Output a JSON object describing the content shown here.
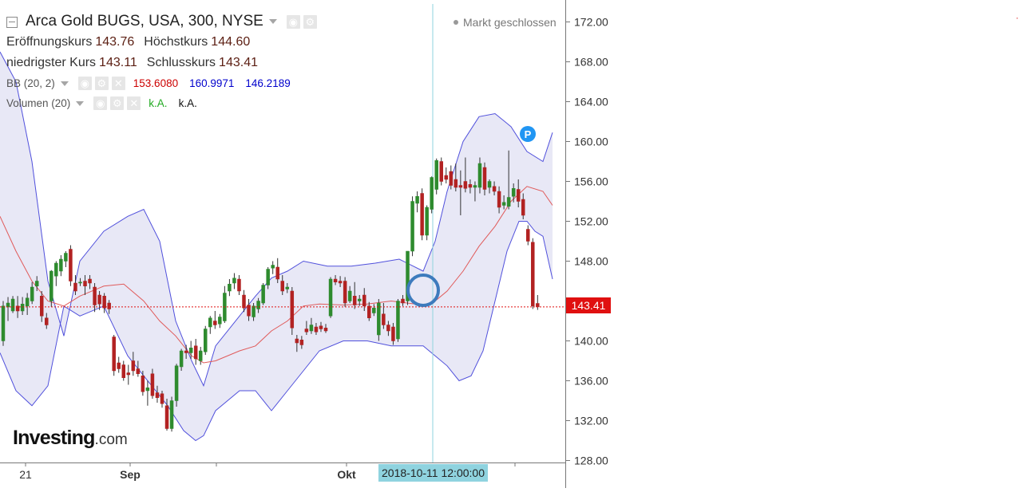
{
  "header": {
    "title": "Arca Gold BUGS, USA, 300, NYSE",
    "market_status": "Markt geschlossen"
  },
  "ohlc": {
    "open_label": "Eröffnungskurs",
    "open": "143.76",
    "high_label": "Höchstkurs",
    "high": "144.60",
    "low_label": "niedrigster Kurs",
    "low": "143.11",
    "close_label": "Schlusskurs",
    "close": "143.41"
  },
  "indicators": {
    "bb": {
      "label": "BB (20, 2)",
      "upper": "153.6080",
      "lower": "160.9971",
      "basis": "146.2189"
    },
    "volume": {
      "label": "Volumen (20)",
      "v1": "k.A.",
      "v2": "k.A."
    }
  },
  "logo": {
    "brand": "Investing",
    "suffix": ".com"
  },
  "price_tag": "143.41",
  "crosshair_time": "2018-10-11 12:00:00",
  "colors": {
    "up": "#2e8b2e",
    "down": "#b22222",
    "bb_band": "#5050dc",
    "bb_fill": "#e4e4f5",
    "bb_basis": "#e05a5a",
    "price_line": "#e01010",
    "crosshair": "#8fd3df",
    "highlight_circle": "#3d7bbd",
    "marker": "#2196f3"
  },
  "chart_data": {
    "type": "candlestick",
    "y_ticks": [
      "172.00",
      "168.00",
      "164.00",
      "160.00",
      "156.00",
      "152.00",
      "148.00",
      "144.00",
      "140.00",
      "136.00",
      "132.00",
      "128.00"
    ],
    "x_ticks": [
      "21",
      "Sep",
      "Okt"
    ],
    "ylim": [
      127.5,
      173.5
    ],
    "last_price": 143.41,
    "event_marker": "P",
    "candles": [
      {
        "o": 140.0,
        "h": 144.0,
        "c": 143.5,
        "l": 139.5
      },
      {
        "o": 143.4,
        "h": 144.4,
        "c": 143.8,
        "l": 142.0
      },
      {
        "o": 143.0,
        "h": 144.5,
        "c": 144.2,
        "l": 142.8
      },
      {
        "o": 143.5,
        "h": 144.5,
        "c": 143.0,
        "l": 142.3
      },
      {
        "o": 143.0,
        "h": 144.4,
        "c": 143.7,
        "l": 142.6
      },
      {
        "o": 143.5,
        "h": 144.8,
        "c": 144.3,
        "l": 142.6
      },
      {
        "o": 144.0,
        "h": 145.9,
        "c": 145.4,
        "l": 143.7
      },
      {
        "o": 145.5,
        "h": 146.5,
        "c": 146.0,
        "l": 145.0
      },
      {
        "o": 144.5,
        "h": 145.0,
        "c": 142.5,
        "l": 141.9
      },
      {
        "o": 142.3,
        "h": 142.8,
        "c": 141.6,
        "l": 141.2
      },
      {
        "o": 144.0,
        "h": 147.1,
        "c": 147.0,
        "l": 143.4
      },
      {
        "o": 146.5,
        "h": 148.0,
        "c": 147.8,
        "l": 145.5
      },
      {
        "o": 147.0,
        "h": 148.6,
        "c": 148.2,
        "l": 146.5
      },
      {
        "o": 148.0,
        "h": 149.0,
        "c": 148.8,
        "l": 147.4
      },
      {
        "o": 149.2,
        "h": 149.6,
        "c": 146.0,
        "l": 145.5
      },
      {
        "o": 145.8,
        "h": 146.6,
        "c": 145.0,
        "l": 144.6
      },
      {
        "o": 145.8,
        "h": 146.3,
        "c": 145.9,
        "l": 145.5
      },
      {
        "o": 146.0,
        "h": 146.6,
        "c": 145.5,
        "l": 144.6
      },
      {
        "o": 146.2,
        "h": 146.6,
        "c": 145.8,
        "l": 145.2
      },
      {
        "o": 145.4,
        "h": 145.8,
        "c": 143.6,
        "l": 142.9
      },
      {
        "o": 144.6,
        "h": 145.0,
        "c": 143.7,
        "l": 143.1
      },
      {
        "o": 144.5,
        "h": 144.8,
        "c": 143.3,
        "l": 142.8
      },
      {
        "o": 143.8,
        "h": 144.1,
        "c": 143.2,
        "l": 142.7
      },
      {
        "o": 140.4,
        "h": 140.6,
        "c": 137.0,
        "l": 136.5
      },
      {
        "o": 137.8,
        "h": 138.4,
        "c": 137.2,
        "l": 136.8
      },
      {
        "o": 137.6,
        "h": 138.0,
        "c": 136.3,
        "l": 136.0
      },
      {
        "o": 136.8,
        "h": 137.6,
        "c": 136.6,
        "l": 135.6
      },
      {
        "o": 138.0,
        "h": 138.9,
        "c": 137.0,
        "l": 136.5
      },
      {
        "o": 137.2,
        "h": 138.0,
        "c": 136.7,
        "l": 136.4
      },
      {
        "o": 136.5,
        "h": 137.0,
        "c": 134.9,
        "l": 134.5
      },
      {
        "o": 135.0,
        "h": 136.0,
        "c": 135.3,
        "l": 133.5
      },
      {
        "o": 136.7,
        "h": 137.2,
        "c": 134.5,
        "l": 134.2
      },
      {
        "o": 134.8,
        "h": 135.5,
        "c": 134.3,
        "l": 133.8
      },
      {
        "o": 134.7,
        "h": 135.0,
        "c": 133.7,
        "l": 133.3
      },
      {
        "o": 133.5,
        "h": 134.2,
        "c": 131.2,
        "l": 131.0
      },
      {
        "o": 131.2,
        "h": 134.4,
        "c": 134.0,
        "l": 130.9
      },
      {
        "o": 134.0,
        "h": 137.7,
        "c": 137.5,
        "l": 133.4
      },
      {
        "o": 137.4,
        "h": 139.2,
        "c": 139.0,
        "l": 137.0
      },
      {
        "o": 139.0,
        "h": 139.6,
        "c": 138.8,
        "l": 138.2
      },
      {
        "o": 138.8,
        "h": 140.0,
        "c": 139.3,
        "l": 138.2
      },
      {
        "o": 139.5,
        "h": 140.2,
        "c": 138.2,
        "l": 137.6
      },
      {
        "o": 138.0,
        "h": 139.4,
        "c": 139.0,
        "l": 137.6
      },
      {
        "o": 138.9,
        "h": 141.5,
        "c": 141.2,
        "l": 138.6
      },
      {
        "o": 141.4,
        "h": 142.5,
        "c": 142.3,
        "l": 140.7
      },
      {
        "o": 142.0,
        "h": 143.0,
        "c": 141.6,
        "l": 141.2
      },
      {
        "o": 141.7,
        "h": 142.7,
        "c": 142.4,
        "l": 141.3
      },
      {
        "o": 142.0,
        "h": 145.5,
        "c": 144.8,
        "l": 141.8
      },
      {
        "o": 145.0,
        "h": 146.2,
        "c": 145.7,
        "l": 144.5
      },
      {
        "o": 145.8,
        "h": 146.8,
        "c": 146.3,
        "l": 145.2
      },
      {
        "o": 146.2,
        "h": 146.6,
        "c": 145.0,
        "l": 144.6
      },
      {
        "o": 144.6,
        "h": 145.1,
        "c": 143.3,
        "l": 142.9
      },
      {
        "o": 143.6,
        "h": 144.2,
        "c": 142.5,
        "l": 142.0
      },
      {
        "o": 142.4,
        "h": 143.8,
        "c": 143.5,
        "l": 142.0
      },
      {
        "o": 143.2,
        "h": 144.3,
        "c": 144.0,
        "l": 142.8
      },
      {
        "o": 143.8,
        "h": 145.8,
        "c": 145.6,
        "l": 143.6
      },
      {
        "o": 145.6,
        "h": 147.4,
        "c": 147.2,
        "l": 145.2
      },
      {
        "o": 147.3,
        "h": 148.0,
        "c": 147.6,
        "l": 146.7
      },
      {
        "o": 147.4,
        "h": 148.3,
        "c": 146.2,
        "l": 145.8
      },
      {
        "o": 146.0,
        "h": 146.6,
        "c": 145.0,
        "l": 144.6
      },
      {
        "o": 145.2,
        "h": 145.8,
        "c": 145.4,
        "l": 144.8
      },
      {
        "o": 145.0,
        "h": 145.4,
        "c": 141.3,
        "l": 140.6
      },
      {
        "o": 140.2,
        "h": 140.6,
        "c": 139.8,
        "l": 138.9
      },
      {
        "o": 140.1,
        "h": 140.5,
        "c": 139.6,
        "l": 139.2
      },
      {
        "o": 141.2,
        "h": 142.0,
        "c": 140.9,
        "l": 140.6
      },
      {
        "o": 141.0,
        "h": 142.3,
        "c": 141.6,
        "l": 140.7
      },
      {
        "o": 141.4,
        "h": 141.8,
        "c": 140.9,
        "l": 140.6
      },
      {
        "o": 141.5,
        "h": 141.9,
        "c": 141.2,
        "l": 140.9
      },
      {
        "o": 141.3,
        "h": 141.7,
        "c": 141.0,
        "l": 140.8
      },
      {
        "o": 142.5,
        "h": 146.4,
        "c": 146.2,
        "l": 142.3
      },
      {
        "o": 146.2,
        "h": 146.6,
        "c": 145.9,
        "l": 145.6
      },
      {
        "o": 146.0,
        "h": 146.5,
        "c": 145.8,
        "l": 145.4
      },
      {
        "o": 146.0,
        "h": 146.4,
        "c": 143.8,
        "l": 143.4
      },
      {
        "o": 144.0,
        "h": 145.5,
        "c": 145.0,
        "l": 143.8
      },
      {
        "o": 144.5,
        "h": 145.9,
        "c": 143.6,
        "l": 143.2
      },
      {
        "o": 144.0,
        "h": 144.6,
        "c": 144.2,
        "l": 143.5
      },
      {
        "o": 144.6,
        "h": 145.3,
        "c": 143.5,
        "l": 143.0
      },
      {
        "o": 143.5,
        "h": 143.9,
        "c": 142.3,
        "l": 142.0
      },
      {
        "o": 142.8,
        "h": 143.7,
        "c": 143.3,
        "l": 142.5
      },
      {
        "o": 140.6,
        "h": 144.2,
        "c": 143.8,
        "l": 140.0
      },
      {
        "o": 142.7,
        "h": 143.8,
        "c": 141.6,
        "l": 141.2
      },
      {
        "o": 141.6,
        "h": 142.0,
        "c": 141.0,
        "l": 140.5
      },
      {
        "o": 141.4,
        "h": 141.8,
        "c": 140.0,
        "l": 139.6
      },
      {
        "o": 140.2,
        "h": 144.2,
        "c": 144.0,
        "l": 139.9
      },
      {
        "o": 144.2,
        "h": 144.6,
        "c": 143.8,
        "l": 143.5
      },
      {
        "o": 144.0,
        "h": 147.2,
        "c": 149.0,
        "l": 143.6
      },
      {
        "o": 149.0,
        "h": 154.5,
        "c": 154.0,
        "l": 148.5
      },
      {
        "o": 153.8,
        "h": 155.0,
        "c": 154.5,
        "l": 152.9
      },
      {
        "o": 154.8,
        "h": 155.3,
        "c": 150.6,
        "l": 150.1
      },
      {
        "o": 150.6,
        "h": 153.6,
        "c": 153.4,
        "l": 150.1
      },
      {
        "o": 153.2,
        "h": 156.5,
        "c": 156.4,
        "l": 152.8
      },
      {
        "o": 155.2,
        "h": 158.3,
        "c": 158.1,
        "l": 154.7
      },
      {
        "o": 158.0,
        "h": 158.4,
        "c": 156.0,
        "l": 155.6
      },
      {
        "o": 156.6,
        "h": 157.4,
        "c": 156.2,
        "l": 155.8
      },
      {
        "o": 157.0,
        "h": 157.6,
        "c": 155.6,
        "l": 155.2
      },
      {
        "o": 156.2,
        "h": 157.8,
        "c": 155.4,
        "l": 155.0
      },
      {
        "o": 155.6,
        "h": 157.1,
        "c": 155.4,
        "l": 152.6
      },
      {
        "o": 156.0,
        "h": 158.4,
        "c": 155.3,
        "l": 154.9
      },
      {
        "o": 155.7,
        "h": 156.2,
        "c": 155.4,
        "l": 154.8
      },
      {
        "o": 155.4,
        "h": 156.0,
        "c": 155.6,
        "l": 154.0
      },
      {
        "o": 155.4,
        "h": 158.4,
        "c": 157.8,
        "l": 154.8
      },
      {
        "o": 157.4,
        "h": 157.9,
        "c": 155.2,
        "l": 154.6
      },
      {
        "o": 155.4,
        "h": 156.2,
        "c": 156.0,
        "l": 154.8
      },
      {
        "o": 155.5,
        "h": 156.0,
        "c": 155.0,
        "l": 154.6
      },
      {
        "o": 155.0,
        "h": 155.5,
        "c": 153.4,
        "l": 152.8
      },
      {
        "o": 153.6,
        "h": 154.6,
        "c": 153.9,
        "l": 153.2
      },
      {
        "o": 153.5,
        "h": 159.1,
        "c": 154.4,
        "l": 153.2
      },
      {
        "o": 154.5,
        "h": 155.8,
        "c": 155.3,
        "l": 153.9
      },
      {
        "o": 155.2,
        "h": 156.2,
        "c": 154.0,
        "l": 153.4
      },
      {
        "o": 154.2,
        "h": 154.8,
        "c": 152.6,
        "l": 152.2
      },
      {
        "o": 151.2,
        "h": 151.6,
        "c": 150.0,
        "l": 149.6
      },
      {
        "o": 149.9,
        "h": 150.3,
        "c": 143.5,
        "l": 143.2
      },
      {
        "o": 143.76,
        "h": 144.6,
        "c": 143.41,
        "l": 143.11
      }
    ],
    "bollinger": {
      "upper": [
        [
          0,
          169.0
        ],
        [
          20,
          166.0
        ],
        [
          40,
          158.0
        ],
        [
          60,
          146.0
        ],
        [
          80,
          140.5
        ],
        [
          100,
          148.0
        ],
        [
          130,
          151.0
        ],
        [
          160,
          152.5
        ],
        [
          180,
          153.2
        ],
        [
          200,
          150.0
        ],
        [
          220,
          142.0
        ],
        [
          240,
          138.0
        ],
        [
          255,
          135.5
        ],
        [
          270,
          139.5
        ],
        [
          300,
          142.5
        ],
        [
          320,
          144.5
        ],
        [
          340,
          146.3
        ],
        [
          360,
          147.0
        ],
        [
          380,
          148.0
        ],
        [
          410,
          147.5
        ],
        [
          440,
          147.5
        ],
        [
          470,
          147.8
        ],
        [
          500,
          148.2
        ],
        [
          530,
          147.0
        ],
        [
          545,
          150.0
        ],
        [
          560,
          155.0
        ],
        [
          580,
          160.0
        ],
        [
          600,
          162.5
        ],
        [
          620,
          162.8
        ],
        [
          640,
          161.5
        ],
        [
          660,
          159.0
        ],
        [
          680,
          158.0
        ],
        [
          692,
          160.9
        ]
      ],
      "lower": [
        [
          0,
          138.8
        ],
        [
          20,
          135.0
        ],
        [
          40,
          133.5
        ],
        [
          60,
          135.5
        ],
        [
          80,
          143.5
        ],
        [
          100,
          142.5
        ],
        [
          130,
          143.5
        ],
        [
          160,
          138.5
        ],
        [
          190,
          135.5
        ],
        [
          210,
          133.5
        ],
        [
          230,
          131.0
        ],
        [
          245,
          130.0
        ],
        [
          255,
          130.5
        ],
        [
          270,
          133.0
        ],
        [
          300,
          135.0
        ],
        [
          320,
          135.0
        ],
        [
          340,
          133.0
        ],
        [
          360,
          135.0
        ],
        [
          380,
          137.0
        ],
        [
          400,
          139.0
        ],
        [
          430,
          140.0
        ],
        [
          460,
          140.0
        ],
        [
          490,
          139.5
        ],
        [
          510,
          139.5
        ],
        [
          530,
          139.5
        ],
        [
          545,
          138.5
        ],
        [
          560,
          137.5
        ],
        [
          575,
          136.0
        ],
        [
          590,
          136.5
        ],
        [
          605,
          139.0
        ],
        [
          620,
          144.0
        ],
        [
          635,
          149.0
        ],
        [
          650,
          152.0
        ],
        [
          660,
          152.0
        ],
        [
          670,
          151.0
        ],
        [
          680,
          150.5
        ],
        [
          692,
          146.2
        ]
      ],
      "basis": [
        [
          0,
          152.5
        ],
        [
          20,
          149.0
        ],
        [
          40,
          146.0
        ],
        [
          60,
          144.0
        ],
        [
          80,
          143.5
        ],
        [
          100,
          144.5
        ],
        [
          130,
          145.5
        ],
        [
          155,
          145.7
        ],
        [
          180,
          144.0
        ],
        [
          200,
          142.0
        ],
        [
          220,
          140.5
        ],
        [
          240,
          138.5
        ],
        [
          255,
          137.8
        ],
        [
          270,
          138.0
        ],
        [
          300,
          139.0
        ],
        [
          320,
          139.5
        ],
        [
          340,
          141.0
        ],
        [
          360,
          142.0
        ],
        [
          380,
          143.5
        ],
        [
          400,
          143.7
        ],
        [
          430,
          143.6
        ],
        [
          460,
          143.7
        ],
        [
          490,
          144.0
        ],
        [
          510,
          143.8
        ],
        [
          530,
          143.6
        ],
        [
          545,
          144.0
        ],
        [
          560,
          145.0
        ],
        [
          580,
          147.0
        ],
        [
          600,
          149.5
        ],
        [
          620,
          151.5
        ],
        [
          640,
          154.0
        ],
        [
          660,
          155.5
        ],
        [
          680,
          155.0
        ],
        [
          692,
          153.6
        ]
      ]
    }
  }
}
